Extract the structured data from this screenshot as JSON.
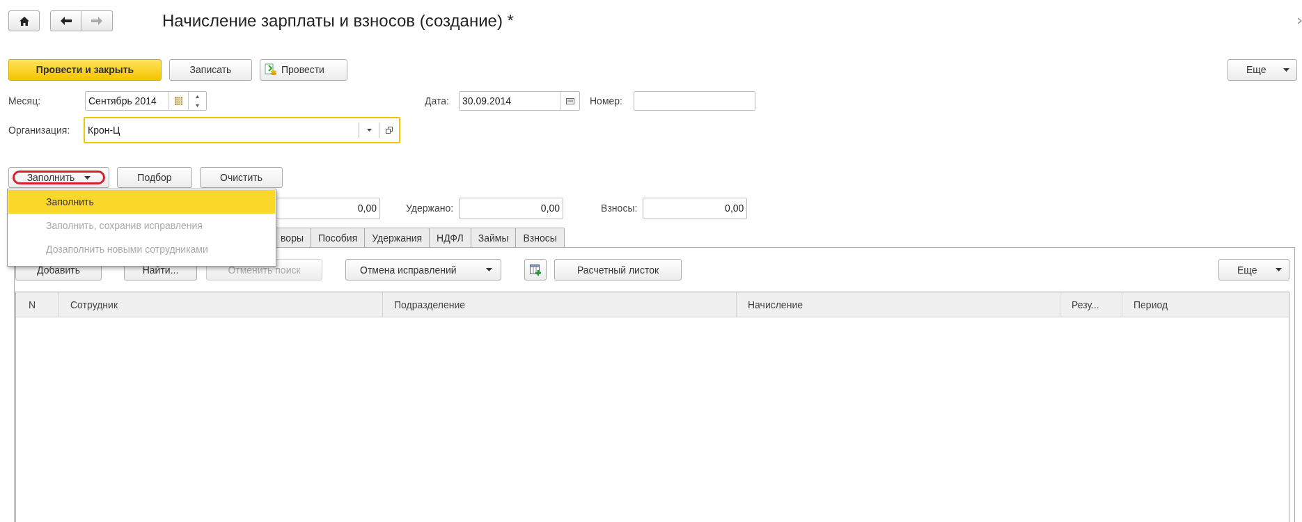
{
  "title": "Начисление зарплаты и взносов (создание) *",
  "command_bar": {
    "buttons": [
      {
        "label": "Провести и закрыть",
        "kind": "primary"
      },
      {
        "label": "Записать",
        "kind": "plain"
      },
      {
        "label": "Провести",
        "kind": "post"
      }
    ],
    "more": "Еще"
  },
  "header": {
    "month": {
      "label": "Месяц:",
      "value": "Сентябрь 2014"
    },
    "date": {
      "label": "Дата:",
      "value": "30.09.2014"
    },
    "number": {
      "label": "Номер:"
    },
    "organization": {
      "label": "Организация:",
      "value": "Крон-Ц"
    }
  },
  "fill_bar": {
    "buttons": [
      {
        "label": "Заполнить",
        "kind": "dropdown",
        "highlighted": true
      },
      {
        "label": "Подбор",
        "kind": "plain",
        "highlighted": false
      },
      {
        "label": "Очистить",
        "kind": "plain",
        "highlighted": false
      }
    ]
  },
  "totals": [
    {
      "value": "0,00"
    },
    {
      "label": "Удержано:",
      "value": "0,00"
    },
    {
      "label": "Взносы:",
      "value": "0,00"
    }
  ],
  "tabs": [
    {
      "label": "воры",
      "selected": false
    },
    {
      "label": "Пособия",
      "selected": false
    },
    {
      "label": "Удержания",
      "selected": false
    },
    {
      "label": "НДФЛ",
      "selected": false
    },
    {
      "label": "Займы",
      "selected": false
    },
    {
      "label": "Взносы",
      "selected": false
    }
  ],
  "table_toolbar": {
    "buttons": [
      {
        "label": "Добавить",
        "kind": "plain",
        "disabled": false
      },
      {
        "label": "Найти...",
        "kind": "plain",
        "disabled": false
      },
      {
        "label": "Отменить поиск",
        "kind": "plain",
        "disabled": true
      },
      {
        "label": "Отмена исправлений",
        "kind": "dropdown",
        "disabled": false
      },
      {
        "kind": "icon",
        "disabled": false
      },
      {
        "label": "Расчетный листок",
        "kind": "plain",
        "disabled": false
      }
    ],
    "more": "Еще"
  },
  "table": {
    "columns": [
      "N",
      "Сотрудник",
      "Подразделение",
      "Начисление",
      "Резу...",
      "Период"
    ]
  },
  "fill_menu": {
    "items": [
      {
        "label": "Заполнить",
        "selected": true,
        "disabled": false
      },
      {
        "label": "Заполнить, сохранив исправления",
        "selected": false,
        "disabled": true
      },
      {
        "label": "Дозаполнить новыми сотрудниками",
        "selected": false,
        "disabled": true
      }
    ]
  }
}
